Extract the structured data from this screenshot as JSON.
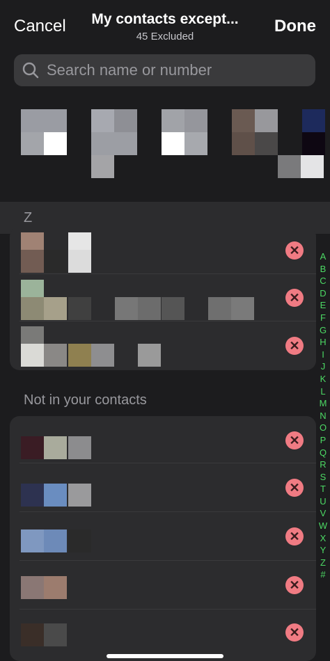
{
  "header": {
    "cancel_label": "Cancel",
    "title": "My contacts except...",
    "subtitle": "45 Excluded",
    "done_label": "Done"
  },
  "search": {
    "placeholder": "Search name or number"
  },
  "section_z_label": "Z",
  "not_in_contacts_label": "Not in your contacts",
  "remove_glyph": "✕",
  "alphabet": [
    "A",
    "B",
    "C",
    "D",
    "E",
    "F",
    "G",
    "H",
    "I",
    "J",
    "K",
    "L",
    "M",
    "N",
    "O",
    "P",
    "Q",
    "R",
    "S",
    "T",
    "U",
    "V",
    "W",
    "X",
    "Y",
    "Z",
    "#"
  ],
  "colors": {
    "background": "#1c1c1e",
    "cell_background": "#2c2c2e",
    "remove_button": "#f07b83",
    "index_accent": "#4cd964"
  }
}
